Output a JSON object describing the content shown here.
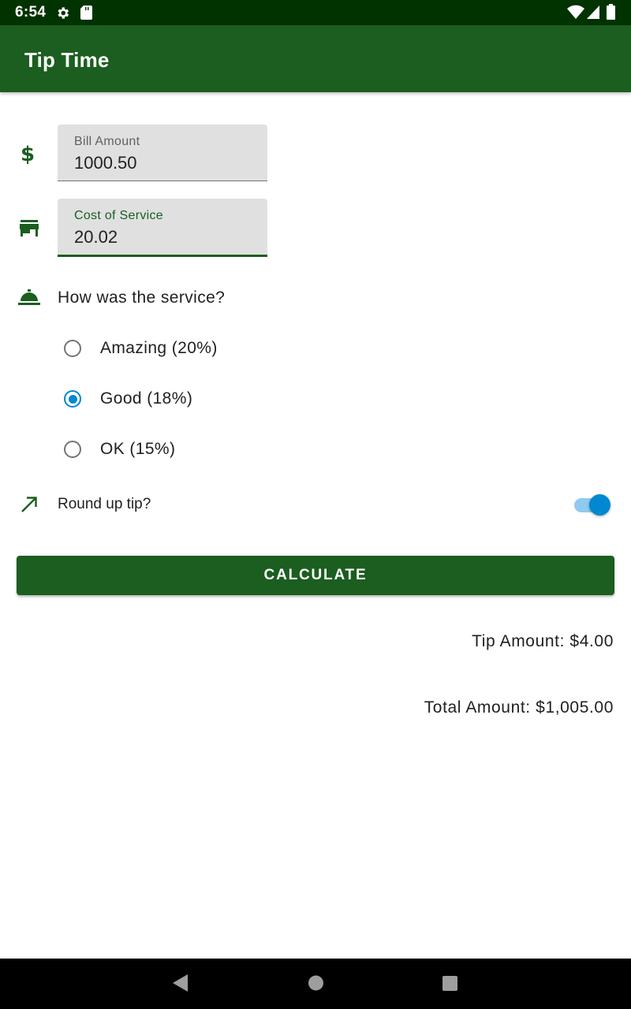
{
  "status_bar": {
    "time": "6:54",
    "icons": [
      "gear-icon",
      "sd-card-icon",
      "wifi-icon",
      "signal-icon",
      "battery-icon"
    ]
  },
  "app_bar": {
    "title": "Tip Time"
  },
  "form": {
    "bill_amount": {
      "label": "Bill Amount",
      "value": "1000.50"
    },
    "cost_of_service": {
      "label": "Cost of Service",
      "value": "20.02"
    },
    "service_question": "How was the service?",
    "options": [
      {
        "label": "Amazing (20%)",
        "checked": false
      },
      {
        "label": "Good (18%)",
        "checked": true
      },
      {
        "label": "OK (15%)",
        "checked": false
      }
    ],
    "round_up": {
      "label": "Round up tip?",
      "enabled": true
    },
    "calculate_label": "CALCULATE"
  },
  "results": {
    "tip": "Tip Amount: $4.00",
    "total": "Total Amount: $1,005.00"
  },
  "colors": {
    "primary": "#1b5e20",
    "primary_dark": "#003300",
    "accent": "#0288d1"
  },
  "nav_bar": {
    "buttons": [
      "back-icon",
      "home-icon",
      "recents-icon"
    ]
  }
}
